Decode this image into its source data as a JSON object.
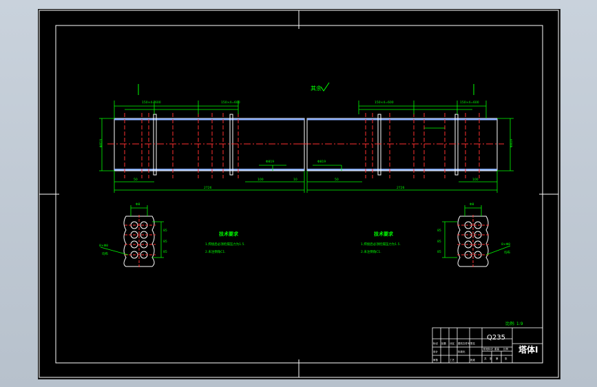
{
  "drawing": {
    "surface_mark": "其余",
    "scale_note": "比例: 1:9",
    "left_body": {
      "top_dims": [
        "150×4=600",
        "150×4=600"
      ],
      "side_dim": "Φ819",
      "bottom_dims": [
        "50",
        "2726",
        "100",
        "10"
      ],
      "inner_dim": "Φ819"
    },
    "right_body": {
      "top_dims": [
        "150×4=600",
        "150×4=600"
      ],
      "side_dim": "Φ819",
      "bottom_dims": [
        "50",
        "2726",
        "100"
      ],
      "inner_dim": "Φ819"
    },
    "left_detail": {
      "top_dim": "Φ8",
      "side_dims": [
        "85",
        "85",
        "85"
      ],
      "label": "8×Φ8",
      "label2": "均布"
    },
    "right_detail": {
      "top_dim": "Φ8",
      "side_dims": [
        "85",
        "85",
        "85"
      ],
      "label": "8×Φ8",
      "label2": "均布"
    },
    "notes_left": {
      "title": "技术要求",
      "lines": [
        "1.焊接后必须检漏压力为1.5.",
        "2.未注倒角C1."
      ]
    },
    "notes_right": {
      "title": "技术要求",
      "lines": [
        "1.焊接后必须检漏压力为1.5.",
        "2.未注倒角C1."
      ]
    }
  },
  "title_block": {
    "material": "Q235",
    "part_name": "塔体Ⅰ",
    "row_labels": [
      "标记",
      "处数",
      "分区",
      "更改文件号",
      "签名",
      "年月日"
    ],
    "row2_labels": [
      "设计",
      "标准化"
    ],
    "row3_labels": [
      "审核",
      "工艺",
      "批准"
    ],
    "right_labels": [
      "阶段标记",
      "重量",
      "比例"
    ],
    "bottom_labels": [
      "共",
      "张",
      "第",
      "张"
    ]
  },
  "colors": {
    "frame": "#ffffff",
    "dimension": "#00ff00",
    "centerline": "#ff0000",
    "shell": "#ffffff",
    "flange": "#ff3030",
    "hatch": "#00c8ff"
  }
}
